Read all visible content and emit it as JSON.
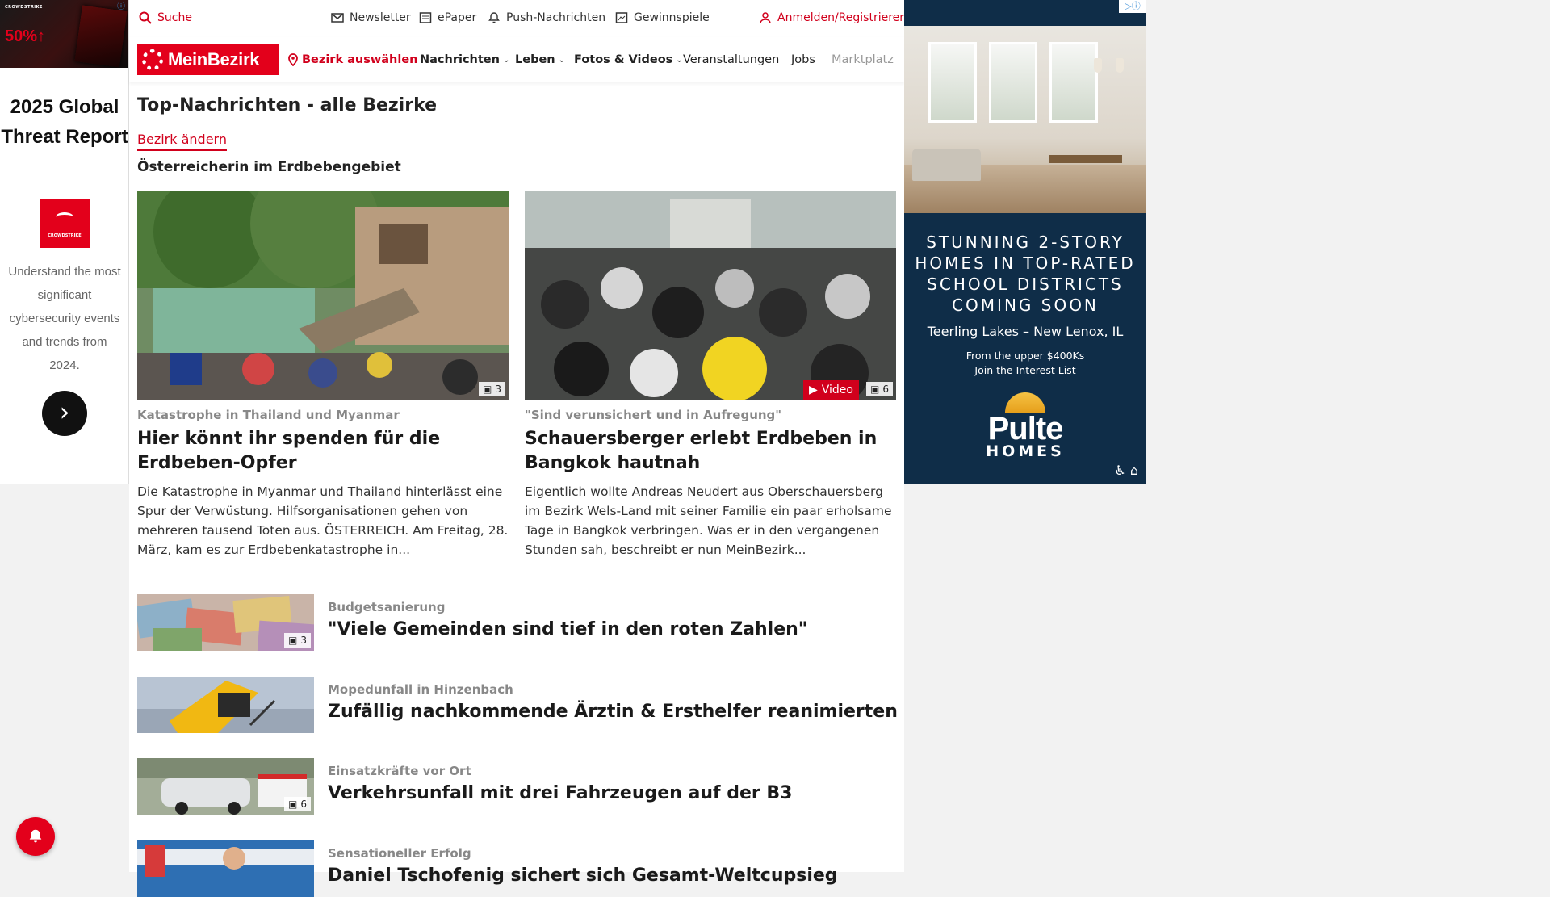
{
  "topbar": {
    "search": "Suche",
    "newsletter": "Newsletter",
    "epaper": "ePaper",
    "push": "Push-Nachrichten",
    "prizes": "Gewinnspiele",
    "login": "Anmelden/Registrieren"
  },
  "nav": {
    "logo": "MeinBezirk",
    "district": "Bezirk auswählen",
    "items": [
      "Nachrichten",
      "Leben",
      "Fotos & Videos",
      "Veranstaltungen",
      "Jobs",
      "Marktplatz"
    ]
  },
  "page": {
    "title": "Top-Nachrichten - alle Bezirke",
    "change_district": "Bezirk ändern",
    "section": "Österreicherin im Erdbebengebiet"
  },
  "featured": [
    {
      "kicker": "Katastrophe in Thailand und Myanmar",
      "title": "Hier könnt ihr spenden für die Erdbeben-Opfer",
      "teaser": "Die Katastrophe in Myanmar und Thailand hinterlässt eine Spur der Verwüstung. Hilfsorganisationen gehen von mehreren tausend Toten aus.  ÖSTERREICH. Am Freitag, 28. März, kam es zur Erdbebenkatastrophe in...",
      "photos": "3"
    },
    {
      "kicker": "\"Sind verunsichert und in Aufregung\"",
      "title": "Schauersberger erlebt Erdbeben in Bangkok hautnah",
      "teaser": "Eigentlich wollte Andreas Neudert aus Oberschauersberg im Bezirk Wels-Land mit seiner Familie ein paar erholsame Tage in Bangkok verbringen. Was er in den vergangenen Stunden sah, beschreibt er nun MeinBezirk...",
      "video": "Video",
      "photos": "6"
    }
  ],
  "articles": [
    {
      "kicker": "Budgetsanierung",
      "title": "\"Viele Gemeinden sind tief in den roten Zahlen\"",
      "photos": "3"
    },
    {
      "kicker": "Mopedunfall in Hinzenbach",
      "title": "Zufällig nachkommende Ärztin & Ersthelfer reanimierten",
      "photos": ""
    },
    {
      "kicker": "Einsatzkräfte vor Ort",
      "title": "Verkehrsunfall mit drei Fahrzeugen auf der B3",
      "photos": "6"
    },
    {
      "kicker": "Sensationeller Erfolg",
      "title": "Daniel Tschofenig sichert sich Gesamt-Weltcupsieg",
      "photos": ""
    }
  ],
  "left_ad": {
    "banner_pct": "50%↑",
    "headline": "2025 Global Threat Report",
    "description": "Understand the most significant cybersecurity events and trends from 2024."
  },
  "right_ad": {
    "headline": "STUNNING 2-STORY HOMES IN TOP-RATED SCHOOL DISTRICTS COMING SOON",
    "location": "Teerling Lakes – New Lenox, IL",
    "price": "From the upper $400Ks",
    "cta": "Join the Interest List",
    "brand": "Pulte",
    "brand_sub": "HOMES"
  },
  "colors": {
    "brand_red": "#e3001b",
    "link_red": "#d1001c",
    "ad_navy": "#0f2d48"
  }
}
